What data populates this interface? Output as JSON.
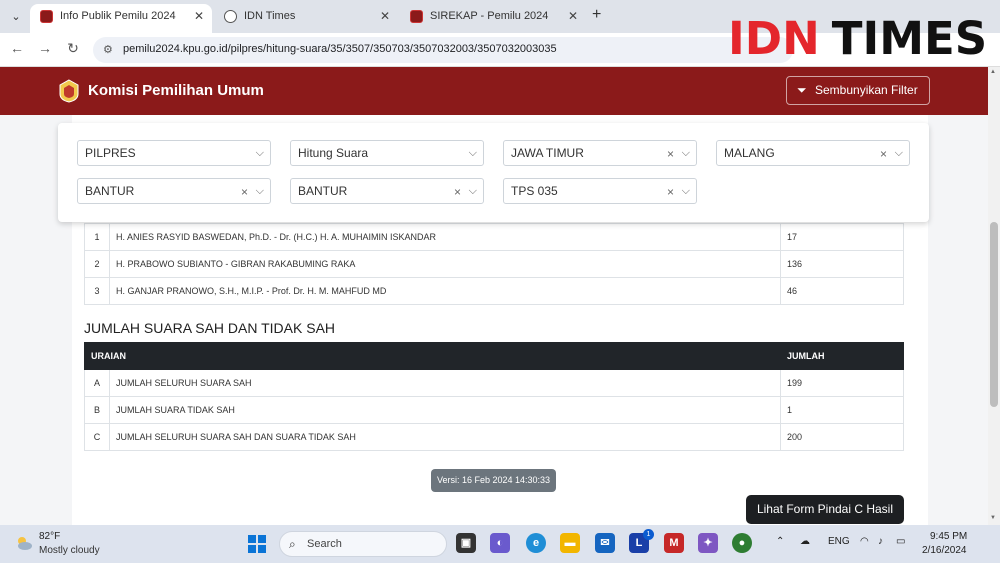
{
  "browser": {
    "tabs": [
      {
        "title": "Info Publik Pemilu 2024",
        "icon": "kpu-favicon",
        "active": true
      },
      {
        "title": "IDN Times",
        "icon": "globe-icon",
        "active": false
      },
      {
        "title": "SIREKAP - Pemilu 2024",
        "icon": "kpu-favicon",
        "active": false
      }
    ],
    "url": "pemilu2024.kpu.go.id/pilpres/hitung-suara/35/3507/350703/3507032003/3507032003035"
  },
  "watermark": {
    "part1": "IDN",
    "part2": "TIMES"
  },
  "header": {
    "title": "Komisi Pemilihan Umum",
    "filter_button": "Sembunyikan Filter"
  },
  "filters": {
    "election": "PILPRES",
    "mode": "Hitung Suara",
    "province": "JAWA TIMUR",
    "regency": "MALANG",
    "district": "BANTUR",
    "village": "BANTUR",
    "tps": "TPS 035"
  },
  "candidates": [
    {
      "no": "1",
      "name": "H. ANIES RASYID BASWEDAN, Ph.D. - Dr. (H.C.) H. A. MUHAIMIN ISKANDAR",
      "votes": "17"
    },
    {
      "no": "2",
      "name": "H. PRABOWO SUBIANTO - GIBRAN RAKABUMING RAKA",
      "votes": "136"
    },
    {
      "no": "3",
      "name": "H. GANJAR PRANOWO, S.H., M.I.P. - Prof. Dr. H. M. MAHFUD MD",
      "votes": "46"
    }
  ],
  "summary": {
    "title": "JUMLAH SUARA SAH DAN TIDAK SAH",
    "col_desc": "URAIAN",
    "col_total": "JUMLAH",
    "rows": [
      {
        "code": "A",
        "label": "JUMLAH SELURUH SUARA SAH",
        "value": "199"
      },
      {
        "code": "B",
        "label": "JUMLAH SUARA TIDAK SAH",
        "value": "1"
      },
      {
        "code": "C",
        "label": "JUMLAH SELURUH SUARA SAH DAN SUARA TIDAK SAH",
        "value": "200"
      }
    ]
  },
  "version": "Versi: 16 Feb 2024 14:30:33",
  "scan_button": "Lihat Form Pindai C Hasil",
  "taskbar": {
    "weather_temp": "82°F",
    "weather_desc": "Mostly cloudy",
    "search_placeholder": "Search",
    "language": "ENG",
    "time": "9:45 PM",
    "date": "2/16/2024",
    "badge_count": "1"
  },
  "colors": {
    "kpu_red": "#8b1a1a",
    "idn_red": "#e4262c",
    "dark": "#212529"
  }
}
